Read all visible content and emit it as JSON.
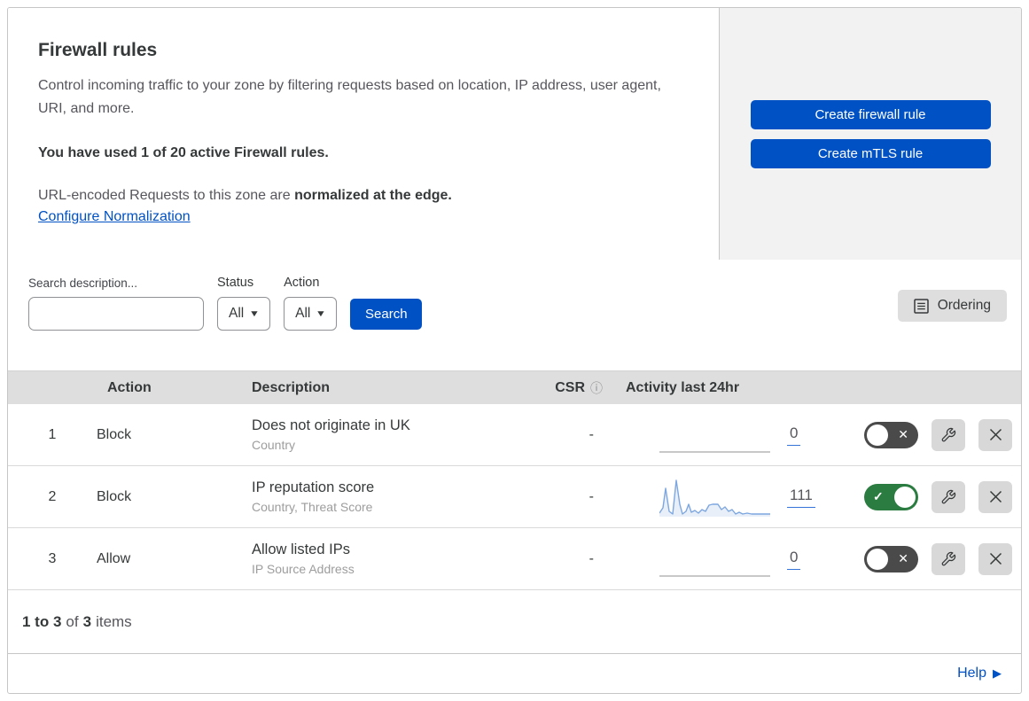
{
  "header": {
    "title": "Firewall rules",
    "description": "Control incoming traffic to your zone by filtering requests based on location, IP address, user agent, URI, and more.",
    "usage_notice": "You have used 1 of 20 active Firewall rules.",
    "normalization_prefix": "URL-encoded Requests to this zone are ",
    "normalization_bold": "normalized at the edge.",
    "normalization_link": "Configure Normalization",
    "create_firewall_button": "Create firewall rule",
    "create_mtls_button": "Create mTLS rule"
  },
  "filters": {
    "search_label": "Search description...",
    "search_value": "",
    "status_label": "Status",
    "status_value": "All",
    "action_label": "Action",
    "action_value": "All",
    "search_button": "Search",
    "ordering_button": "Ordering"
  },
  "table": {
    "headers": {
      "action": "Action",
      "description": "Description",
      "csr": "CSR",
      "activity": "Activity last 24hr"
    },
    "rows": [
      {
        "index": "1",
        "action": "Block",
        "description": "Does not originate in UK",
        "fields": "Country",
        "csr": "-",
        "activity_count": "0",
        "enabled": false
      },
      {
        "index": "2",
        "action": "Block",
        "description": "IP reputation score",
        "fields": "Country, Threat Score",
        "csr": "-",
        "activity_count": "111",
        "enabled": true
      },
      {
        "index": "3",
        "action": "Allow",
        "description": "Allow listed IPs",
        "fields": "IP Source Address",
        "csr": "-",
        "activity_count": "0",
        "enabled": false
      }
    ]
  },
  "sparklines": {
    "flat_line": "0,41 125,41",
    "rule2_line": "0,40 4,34 7,12 11,38 15,41 19,3 23,30 26,41 30,38 33,30 36,39 40,37 44,40 48,36 52,38 56,31 60,30 66,30 70,36 74,33 78,38 82,36 86,41 90,39 94,41 99,40 104,41 110,41 116,41 125,41",
    "rule2_fill": "0,40 4,34 7,12 11,38 15,41 19,3 23,30 26,41 30,38 33,30 36,39 40,37 44,40 48,36 52,38 56,31 60,30 66,30 70,36 74,33 78,38 82,36 86,41 90,39 94,41 99,40 104,41 110,41 116,41 125,41 125,44 0,44"
  },
  "pagination": {
    "range": "1 to 3",
    "of": "of",
    "total": "3",
    "items": "items"
  },
  "footer": {
    "help": "Help"
  },
  "toggle_marks": {
    "on": "✓",
    "off": "✕"
  },
  "icons": {
    "chevron": "▼",
    "info": "ⓘ",
    "help_arrow": "▶"
  },
  "colors": {
    "accent_blue": "#0051c3",
    "toggle_on_green": "#2b7c40",
    "toggle_off_gray": "#4a4a4a",
    "sparkline_blue": "#7da7e0",
    "count_underline_blue": "#3573d9",
    "table_header_bg": "#dedede",
    "panel_gray": "#f2f2f2"
  }
}
